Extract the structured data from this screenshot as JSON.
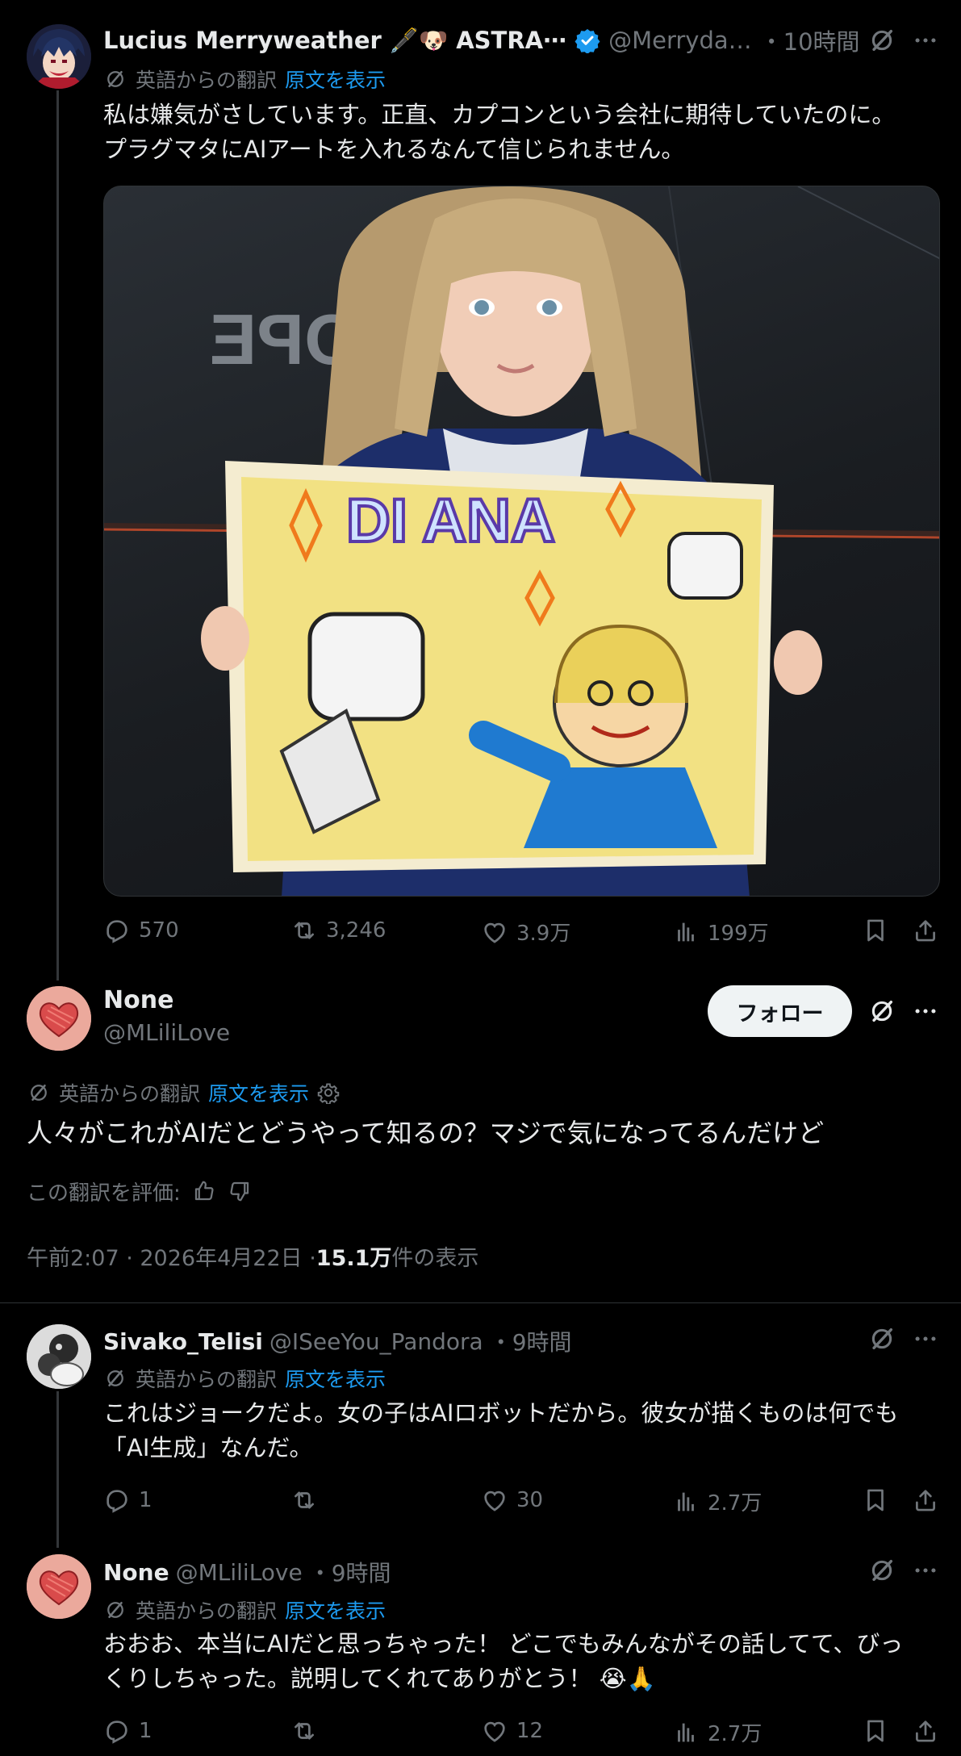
{
  "colors": {
    "background": "#000000",
    "text": "#e7e9ea",
    "muted": "#71767b",
    "link": "#1d9bf0",
    "verified": "#1d9bf0",
    "follow_bg": "#eff3f4"
  },
  "quoted_post": {
    "author_name": "Lucius Merryweather 🖋️🐶 ASTRA⋯",
    "handle": "@Merryda…",
    "time": "・10時間",
    "translation_label": "英語からの翻訳",
    "show_original": "原文を表示",
    "text_line1": "私は嫌気がさしています。正直、カプコンという会社に期待していたのに。",
    "text_line2": "プラグマタにAIアートを入れるなんて信じられません。",
    "image_alt": "Girl in space suit holding crayon drawing",
    "image_drawing_text": "DI ANA",
    "image_background_text": "HOPE",
    "stats": {
      "replies": "570",
      "reposts": "3,246",
      "likes": "3.9万",
      "views": "199万"
    }
  },
  "main_post": {
    "author_name": "None",
    "handle": "@MLiliLove",
    "follow_label": "フォロー",
    "translation_label": "英語からの翻訳",
    "show_original": "原文を表示",
    "text": "人々がこれがAIだとどうやって知るの？マジで気になってるんだけど",
    "rate_label": "この翻訳を評価:",
    "timestamp": "午前2:07 · 2026年4月22日 · ",
    "views_count": "15.1万",
    "views_label": " 件の表示"
  },
  "replies": [
    {
      "author_name": "Sivako_Telisi",
      "handle": "@ISeeYou_Pandora",
      "time": "・9時間",
      "translation_label": "英語からの翻訳",
      "show_original": "原文を表示",
      "text_line1": "これはジョークだよ。女の子はAIロボットだから。彼女が描くものは何でも",
      "text_line2": "「AI生成」なんだ。",
      "stats": {
        "replies": "1",
        "reposts": "",
        "likes": "30",
        "views": "2.7万"
      }
    },
    {
      "author_name": "None",
      "handle": "@MLiliLove",
      "time": "・9時間",
      "translation_label": "英語からの翻訳",
      "show_original": "原文を表示",
      "text_line1": "おおお、本当にAIだと思っちゃった！ どこでもみんながその話してて、びっ",
      "text_line2": "くりしちゃった。説明してくれてありがとう！ 😭🙏",
      "stats": {
        "replies": "1",
        "reposts": "",
        "likes": "12",
        "views": "2.7万"
      }
    }
  ]
}
